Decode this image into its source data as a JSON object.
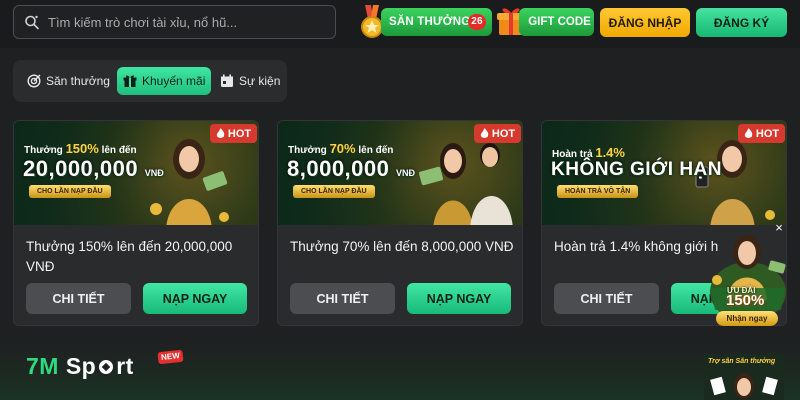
{
  "header": {
    "search_placeholder": "Tìm kiếm trò chơi tài xỉu, nổ hũ...",
    "hunt_label": "SĂN THƯỞNG",
    "hunt_count": "26",
    "gift_label": "GIFT CODE",
    "login_label": "ĐĂNG NHẬP",
    "register_label": "ĐĂNG KÝ"
  },
  "tabs": [
    {
      "label": "Săn thưởng",
      "icon": "target-icon",
      "active": false
    },
    {
      "label": "Khuyến mãi",
      "icon": "gift-icon",
      "active": true
    },
    {
      "label": "Sự kiện",
      "icon": "calendar-icon",
      "active": false
    }
  ],
  "cards": [
    {
      "banner_line1_prefix": "Thưởng ",
      "banner_line1_highlight": "150%",
      "banner_line1_suffix": " lên đến",
      "banner_big": "20,000,000",
      "banner_unit": "VNĐ",
      "banner_pill": "CHO LẦN NẠP ĐẦU",
      "hot": "HOT",
      "title": "Thưởng 150% lên đến 20,000,000 VNĐ",
      "detail": "CHI TIẾT",
      "deposit": "NẠP NGAY"
    },
    {
      "banner_line1_prefix": "Thưởng ",
      "banner_line1_highlight": "70%",
      "banner_line1_suffix": " lên đến",
      "banner_big": "8,000,000",
      "banner_unit": "VNĐ",
      "banner_pill": "CHO LẦN NẠP ĐẦU",
      "hot": "HOT",
      "title": "Thưởng 70% lên đến 8,000,000 VNĐ",
      "detail": "CHI TIẾT",
      "deposit": "NẠP NGAY"
    },
    {
      "banner_line1_prefix": "Hoàn trả ",
      "banner_line1_highlight": "1.4%",
      "banner_line1_suffix": "",
      "banner_big": "KHÔNG GIỚI HẠN",
      "banner_unit": "",
      "banner_pill": "HOÀN TRẢ VÔ TẬN",
      "hot": "HOT",
      "title": "Hoàn trả 1.4% không giới h",
      "detail": "CHI TIẾT",
      "deposit": "NẠP NGAY"
    }
  ],
  "promo": {
    "close": "×",
    "label1": "ƯU ĐÃI",
    "percent": "150%",
    "cta": "Nhận ngay"
  },
  "footer": {
    "logo_main": "7M",
    "logo_sub": "Sp",
    "logo_tail": "rt",
    "new_badge": "NEW",
    "ad_text": "Trợ sân Săn thưởng"
  },
  "colors": {
    "accent_green": "#1fc07e",
    "login_yellow": "#f0a800",
    "hot_red": "#d63a2f",
    "bg": "#1f2021"
  }
}
